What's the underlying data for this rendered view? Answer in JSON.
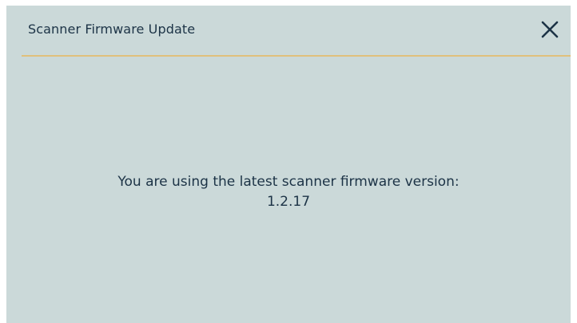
{
  "dialog": {
    "title": "Scanner Firmware Update",
    "close_icon": "close-icon",
    "message_line1": "You are using the latest scanner firmware version:",
    "firmware_version": "1.2.17"
  },
  "colors": {
    "dialog_background": "#cbd9d9",
    "text": "#1c3346",
    "divider_accent": "#e0c07c"
  }
}
